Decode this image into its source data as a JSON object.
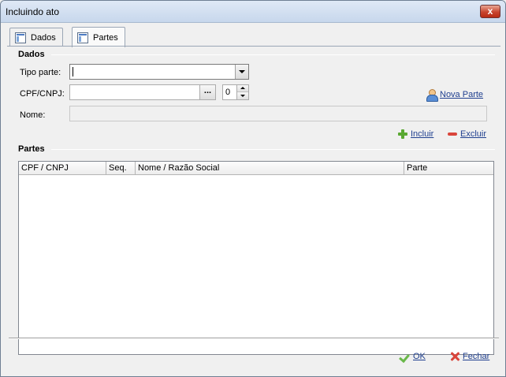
{
  "window": {
    "title": "Incluindo ato",
    "close_glyph": "x"
  },
  "tabs": [
    {
      "label": "Dados",
      "icon": "form-icon",
      "active": false
    },
    {
      "label": "Partes",
      "icon": "form-icon",
      "active": true
    }
  ],
  "dados": {
    "group_label": "Dados",
    "tipo_parte_label": "Tipo parte:",
    "tipo_parte_value": "",
    "cpf_cnpj_label": "CPF/CNPJ:",
    "cpf_cnpj_value": "",
    "ellipsis_label": "...",
    "seq_value": "0",
    "nome_label": "Nome:",
    "nome_value": "",
    "nova_parte_label": "Nova Parte",
    "incluir_label": "Incluir",
    "excluir_label": "Excluir"
  },
  "partes": {
    "group_label": "Partes",
    "columns": [
      "CPF / CNPJ",
      "Seq.",
      "Nome / Razão Social",
      "Parte"
    ],
    "rows": []
  },
  "footer": {
    "ok_label": "OK",
    "fechar_label": "Fechar"
  },
  "colors": {
    "link": "#1f3f8f",
    "add_green": "#5aa832",
    "remove_red": "#d9453b"
  }
}
